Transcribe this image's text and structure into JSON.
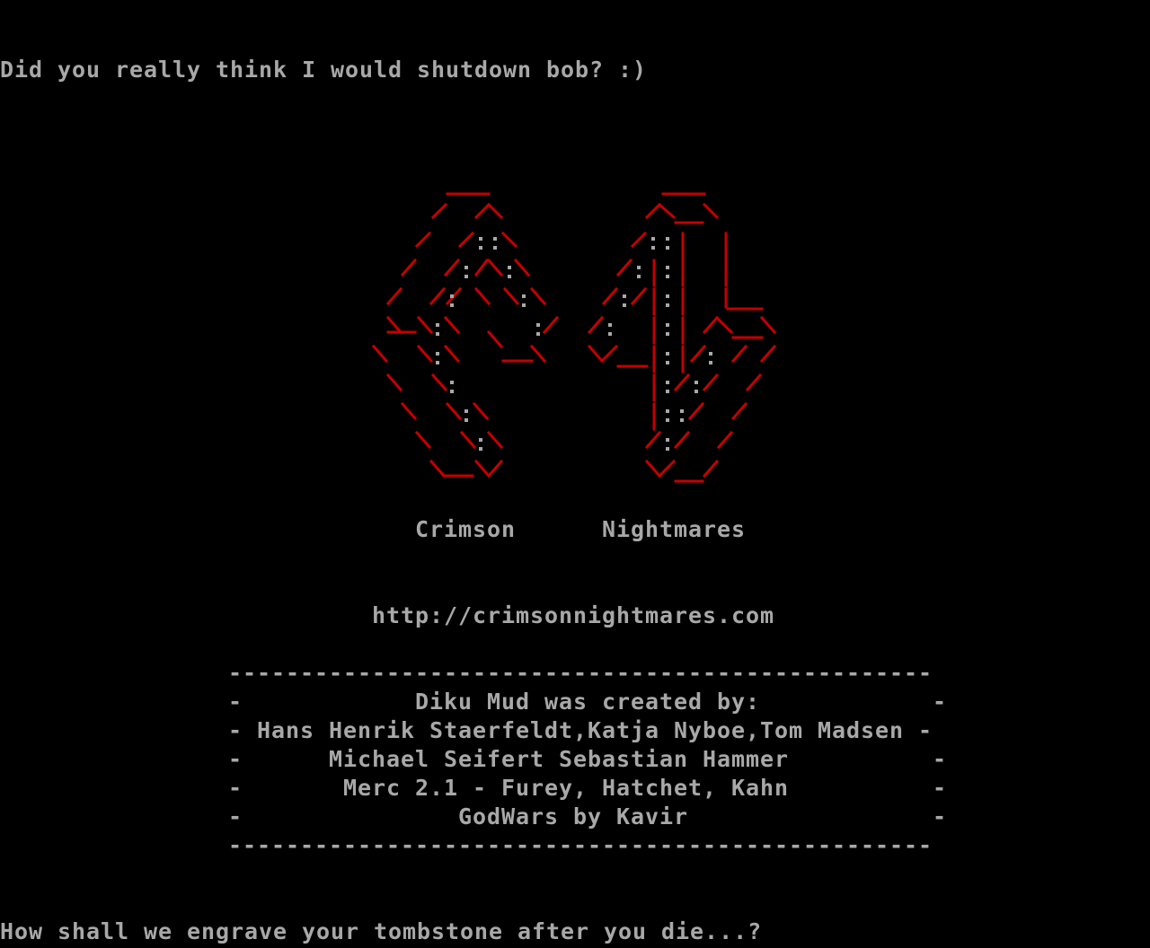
{
  "terminal": {
    "line_top": "Did you really think I would shutdown bob? :)",
    "logo_left_word": "Crimson",
    "logo_right_word": "Nightmares",
    "url": "http://crimsonnightmares.com",
    "rule": "-------------------------------------------------",
    "credits": [
      "-            Diku Mud was created by:            -",
      "- Hans Henrik Staerfeldt,Katja Nyboe,Tom Madsen -",
      "-      Michael Seifert Sebastian Hammer          -",
      "-       Merc 2.1 - Furey, Hatchet, Kahn          -",
      "-               GodWars by Kavir                 -"
    ],
    "prompt": "How shall we engrave your tombstone after you die...?"
  },
  "colors": {
    "background": "#000000",
    "text": "#a8a8a8",
    "logo_red": "#c40000"
  }
}
